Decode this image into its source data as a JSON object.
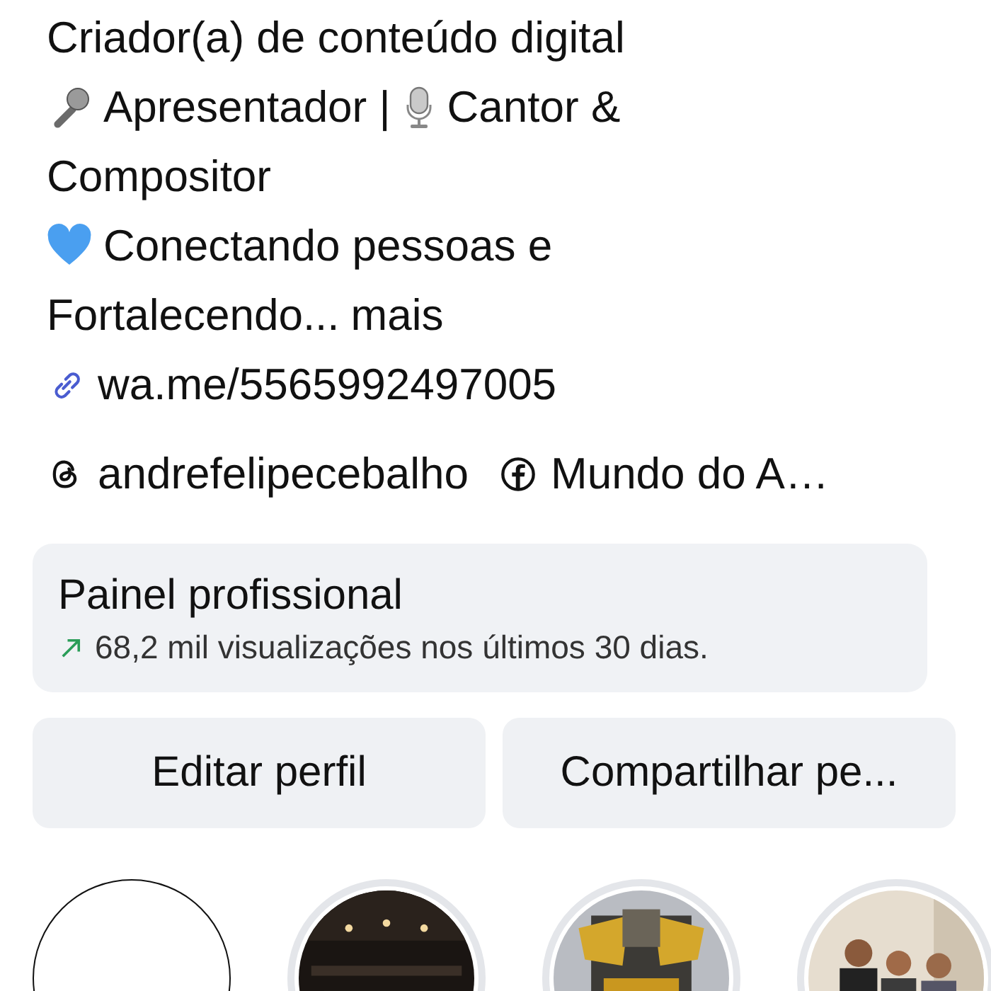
{
  "profile": {
    "category": "Criador(a) de conteúdo digital",
    "bio_lines": [
      [
        {
          "kind": "mic"
        },
        {
          "kind": "text",
          "text": "Apresentador |"
        },
        {
          "kind": "studio-mic"
        },
        {
          "kind": "text",
          "text": "Cantor &"
        }
      ],
      [
        {
          "kind": "text",
          "text": "Compositor"
        }
      ],
      [
        {
          "kind": "heart"
        },
        {
          "kind": "text",
          "text": "Conectando pessoas e"
        }
      ],
      [
        {
          "kind": "text",
          "text": "Fortalecendo..."
        },
        {
          "kind": "more",
          "text": "mais"
        }
      ]
    ],
    "link": "wa.me/5565992497005",
    "accounts": [
      {
        "kind": "threads",
        "text": "andrefelipecebalho"
      },
      {
        "kind": "facebook",
        "text": "Mundo do A…"
      }
    ]
  },
  "dashboard": {
    "title": "Painel profissional",
    "stat": "68,2 mil visualizações nos últimos 30 dias."
  },
  "buttons": [
    "Editar perfil",
    "Compartilhar pe..."
  ],
  "highlights": [
    {
      "kind": "new"
    },
    {
      "kind": "picture"
    },
    {
      "kind": "picture"
    },
    {
      "kind": "picture"
    }
  ]
}
